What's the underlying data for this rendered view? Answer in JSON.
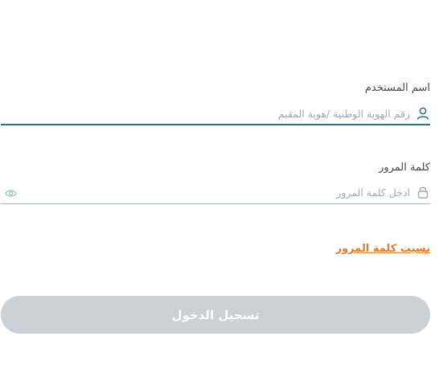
{
  "form": {
    "username": {
      "label": "اسم المستخدم",
      "placeholder": "رقم الهوية الوطنية /هوية المقيم",
      "value": "",
      "icon": "user-icon"
    },
    "password": {
      "label": "كلمة المرور",
      "placeholder": "ادخل كلمة المرور",
      "value": "",
      "icon": "lock-icon",
      "toggle_icon": "eye-icon"
    },
    "forgot_password_label": "نسيت كلمة المرور",
    "login_button_label": "تسجيل الدخول"
  },
  "colors": {
    "accent": "#2f6f82",
    "link": "#e07a2f",
    "button_disabled": "#c9d1d7"
  }
}
